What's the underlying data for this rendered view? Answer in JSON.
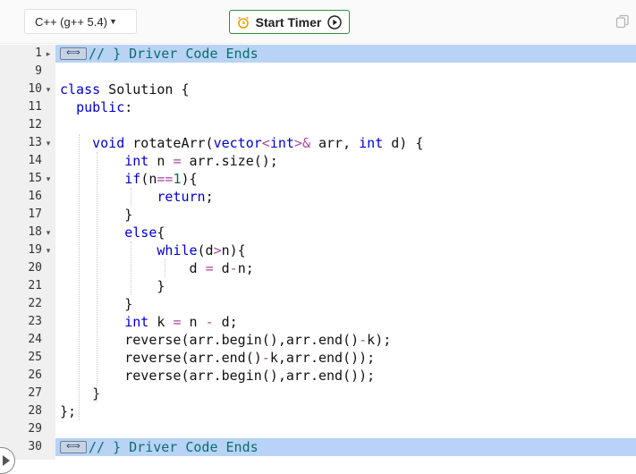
{
  "toolbar": {
    "language": "C++ (g++ 5.4)",
    "timer_label": "Start Timer",
    "accent": "#2f8d46"
  },
  "icons": {
    "timer": "alarm-clock-icon",
    "play": "play-circle-icon",
    "copy": "copy-icon",
    "run": "run-arrow-icon"
  },
  "editor": {
    "highlight_color": "#b8d3f5",
    "lines": [
      {
        "num": "1",
        "fold": "▸",
        "text": "// } Driver Code Ends"
      },
      {
        "num": "9",
        "fold": "",
        "text": ""
      },
      {
        "num": "10",
        "fold": "▾",
        "text": "class Solution {"
      },
      {
        "num": "11",
        "fold": "",
        "text": "  public:"
      },
      {
        "num": "12",
        "fold": "",
        "text": ""
      },
      {
        "num": "13",
        "fold": "▾",
        "text": "    void rotateArr(vector<int>& arr, int d) {"
      },
      {
        "num": "14",
        "fold": "",
        "text": "        int n = arr.size();"
      },
      {
        "num": "15",
        "fold": "▾",
        "text": "        if(n==1){"
      },
      {
        "num": "16",
        "fold": "",
        "text": "            return;"
      },
      {
        "num": "17",
        "fold": "",
        "text": "        }"
      },
      {
        "num": "18",
        "fold": "▾",
        "text": "        else{"
      },
      {
        "num": "19",
        "fold": "▾",
        "text": "            while(d>n){"
      },
      {
        "num": "20",
        "fold": "",
        "text": "                d = d-n;"
      },
      {
        "num": "21",
        "fold": "",
        "text": "            }"
      },
      {
        "num": "22",
        "fold": "",
        "text": "        }"
      },
      {
        "num": "23",
        "fold": "",
        "text": "        int k = n - d;"
      },
      {
        "num": "24",
        "fold": "",
        "text": "        reverse(arr.begin(),arr.end()-k);"
      },
      {
        "num": "25",
        "fold": "",
        "text": "        reverse(arr.end()-k,arr.end());"
      },
      {
        "num": "26",
        "fold": "",
        "text": "        reverse(arr.begin(),arr.end());"
      },
      {
        "num": "27",
        "fold": "",
        "text": "    }"
      },
      {
        "num": "28",
        "fold": "",
        "text": "};"
      },
      {
        "num": "29",
        "fold": "",
        "text": ""
      },
      {
        "num": "30",
        "fold": "",
        "text": "// } Driver Code Ends"
      }
    ]
  }
}
